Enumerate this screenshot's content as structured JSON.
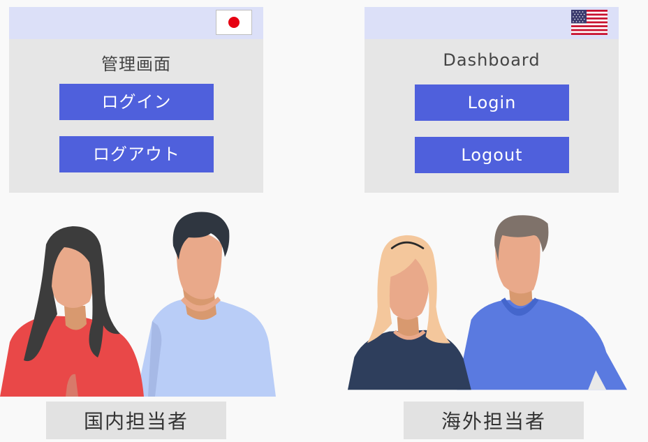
{
  "jp_panel": {
    "flag_icon": "japan-flag-icon",
    "title": "管理画面",
    "login_label": "ログイン",
    "logout_label": "ログアウト"
  },
  "us_panel": {
    "flag_icon": "usa-flag-icon",
    "title": "Dashboard",
    "login_label": "Login",
    "logout_label": "Logout"
  },
  "domestic_caption": "国内担当者",
  "overseas_caption": "海外担当者",
  "colors": {
    "panel_bar": "#dce0f8",
    "panel_body": "#e6e6e6",
    "button": "#4f60dc",
    "caption_bg": "#e2e2e2",
    "background": "#f9f9f9"
  }
}
